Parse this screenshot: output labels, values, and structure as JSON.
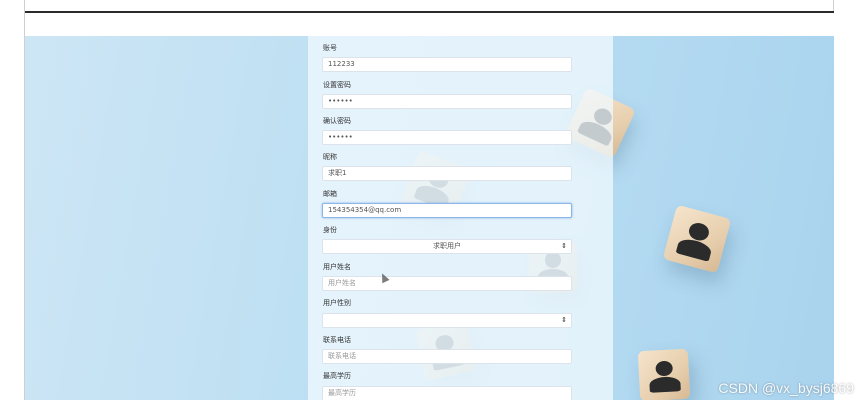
{
  "form": {
    "account": {
      "label": "账号",
      "value": "112233"
    },
    "password": {
      "label": "设置密码",
      "value": "••••••"
    },
    "confirm_password": {
      "label": "确认密码",
      "value": "••••••"
    },
    "nickname": {
      "label": "昵称",
      "value": "求职1"
    },
    "email": {
      "label": "邮箱",
      "value": "154354354@qq.com"
    },
    "identity": {
      "label": "身份",
      "value": "求职用户"
    },
    "user_name": {
      "label": "用户姓名",
      "placeholder": "用户姓名"
    },
    "user_gender": {
      "label": "用户性别",
      "value": ""
    },
    "phone": {
      "label": "联系电话",
      "placeholder": "联系电话"
    },
    "education": {
      "label": "最高学历",
      "placeholder": "最高学历"
    }
  },
  "watermark": "CSDN @vx_bysj6869",
  "icons": {
    "select_arrow": "⇕"
  }
}
